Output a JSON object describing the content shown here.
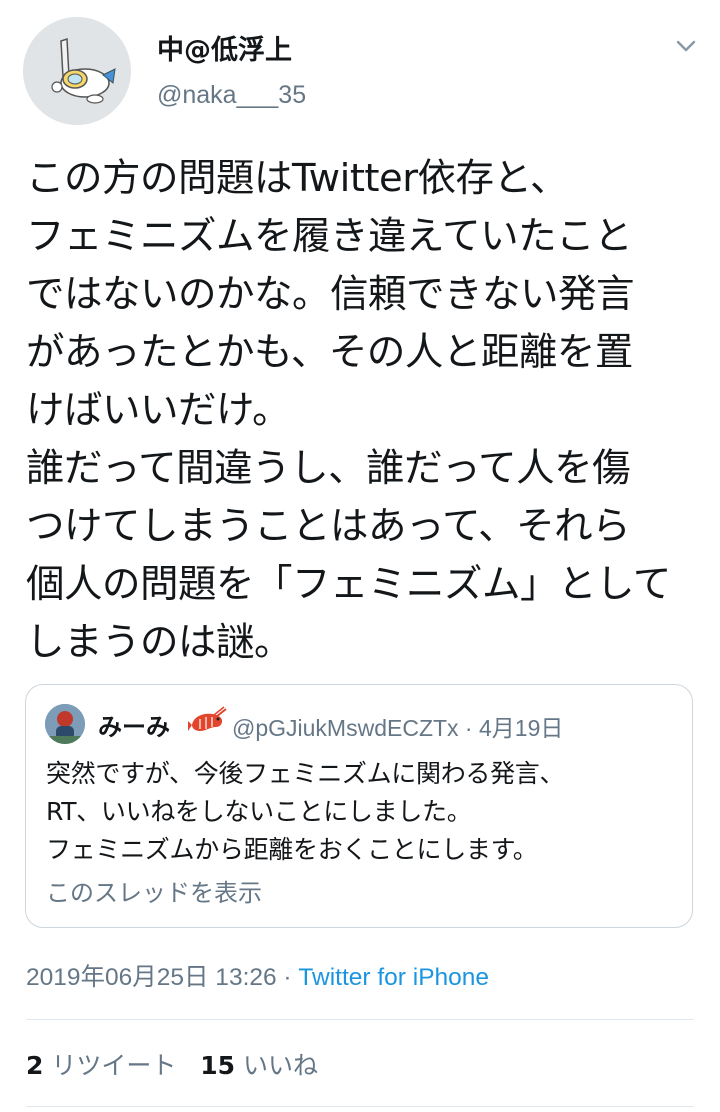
{
  "user": {
    "display_name": "中@低浮上",
    "handle": "@naka___35",
    "avatar_icon": "snorkel-character-icon"
  },
  "tweet": {
    "lines": [
      "この方の問題はTwitter依存と、",
      "フェミニズムを履き違えていたこと",
      "ではないのかな。信頼できない発言",
      "があったとかも、その人と距離を置",
      "けばいいだけ。",
      "誰だって間違うし、誰だって人を傷",
      "つけてしまうことはあって、それら",
      "個人の問題を「フェミニズム」として",
      "しまうのは謎。"
    ]
  },
  "quote": {
    "display_name": "みーみ",
    "name_emoji": "shrimp-icon",
    "handle_date": "@pGJiukMswdECZTx · 4月19日",
    "lines": [
      "突然ですが、今後フェミニズムに関わる発言、",
      "RT、いいねをしないことにしました。",
      "フェミニズムから距離をおくことにします。"
    ],
    "show_thread": "このスレッドを表示"
  },
  "meta": {
    "timestamp": "2019年06月25日 13:26",
    "separator": " · ",
    "source": "Twitter for iPhone"
  },
  "stats": {
    "retweets_count": "2",
    "retweets_label": "リツイート",
    "likes_count": "15",
    "likes_label": "いいね"
  },
  "colors": {
    "text": "#14171a",
    "secondary": "#657786",
    "link": "#1b95e0",
    "border": "#ccd6dd"
  }
}
